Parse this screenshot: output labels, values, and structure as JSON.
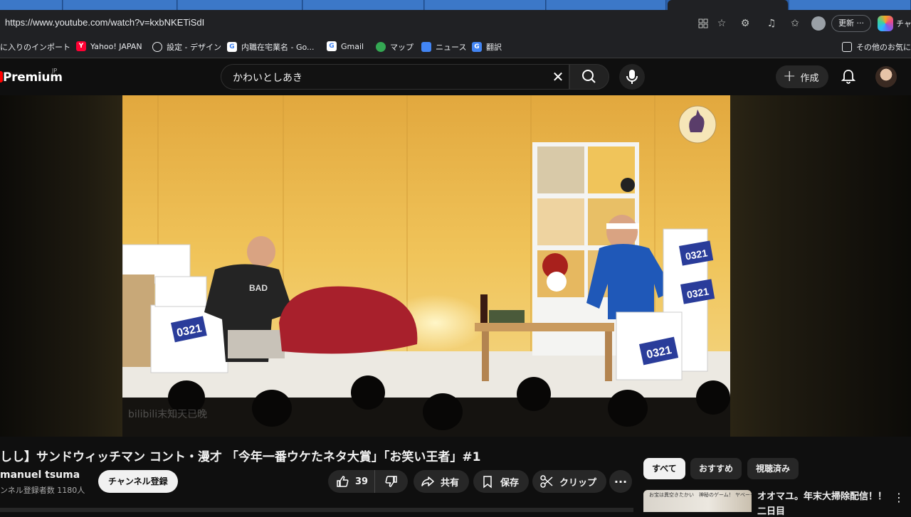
{
  "browser": {
    "tabs": [
      "",
      "",
      "",
      "",
      "",
      "",
      "",
      "",
      "",
      ""
    ],
    "url": "https://www.youtube.com/watch?v=kxbNKETiSdI",
    "update_label": "更新",
    "update_more": "···",
    "copilot_label": "チャッ",
    "bookmarks": [
      {
        "label": "に入りのインポート",
        "icon": ""
      },
      {
        "label": "Yahoo! JAPAN",
        "icon": "Y"
      },
      {
        "label": "設定 - デザイン",
        "icon": ""
      },
      {
        "label": "内職在宅業名 - Go...",
        "icon": "G"
      },
      {
        "label": "Gmail",
        "icon": "G"
      },
      {
        "label": "マップ",
        "icon": ""
      },
      {
        "label": "ニュース",
        "icon": ""
      },
      {
        "label": "翻訳",
        "icon": "G"
      }
    ],
    "other_bookmarks": "その他のお気に入"
  },
  "youtube": {
    "logo_text": "Premium",
    "logo_region": "JP",
    "search_query": "かわいとしあき",
    "create_label": "作成"
  },
  "video": {
    "watermark": "bilibili末知天已晚",
    "title": "しし】サンドウィッチマン コント・漫才 「今年一番ウケたネタ大賞」「お笑い王者」#1",
    "channel_name": "manuel tsuma",
    "subscriber_text": "ンネル登録者数 1180人",
    "subscribe_label": "チャンネル登録",
    "like_count": "39",
    "share_label": "共有",
    "save_label": "保存",
    "clip_label": "クリップ",
    "more_label": "···",
    "box_label": "0321",
    "shirt_label": "BAD"
  },
  "sidebar": {
    "chips": [
      {
        "label": "すべて",
        "active": true
      },
      {
        "label": "おすすめ",
        "active": false
      },
      {
        "label": "視聴済み",
        "active": false
      }
    ],
    "recommendation": {
      "title_line1": "オオマユ。年末大掃除配信！！",
      "title_line2": "二日目",
      "thumb_text": "お宝は異空きたかい　神秘のゲーム！ ヤベーぞ!!"
    }
  },
  "colors": {
    "background": "#0f0f0f",
    "brand_red": "#ff0000",
    "stage_wall": "#e9b54a",
    "chip_active": "#f1f1f1"
  }
}
